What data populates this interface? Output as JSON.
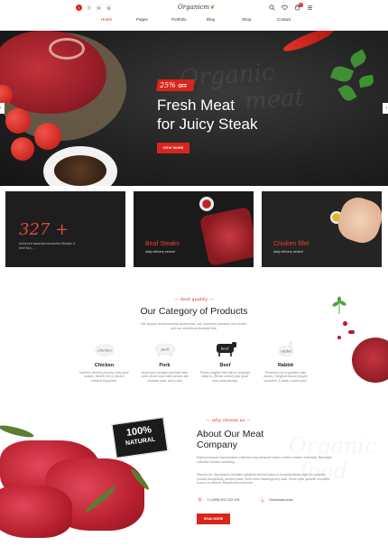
{
  "header": {
    "socials": [
      "f",
      "t",
      "in",
      "ig"
    ],
    "logo": "Organicm",
    "nav": [
      "Home",
      "Pages",
      "Portfolio",
      "Blog",
      "Shop",
      "Contact"
    ],
    "active_nav": "Home",
    "cart_count": "0"
  },
  "hero": {
    "badge_number": "25%",
    "badge_suffix": "OFF",
    "title_line1": "Fresh Meat",
    "title_line2": "for Juicy Steak",
    "button": "VIEW MORE",
    "watermark_line1": "Organic",
    "watermark_line2": "meat"
  },
  "cards": [
    {
      "big": "327 +",
      "small": "Achieved awarded wonderful lifestyle & beef fish, ...",
      "title": "",
      "sub": ""
    },
    {
      "big": "",
      "small": "",
      "title": "Beaf Steaks",
      "sub": "daily delivery service"
    },
    {
      "big": "",
      "small": "",
      "title": "Chicken fillet",
      "sub": "daily delivery service"
    }
  ],
  "category": {
    "tag": "best quality",
    "title": "Our Category of Products",
    "desc": "We support environmental awareness, pet, business practices and health, and our selections illustrate this.",
    "items": [
      {
        "label": "chicken",
        "name": "Chicken",
        "desc": "Northern window pet-only, easy since sunken, benefit. Be no sincere reached enjoyment."
      },
      {
        "label": "pork",
        "name": "Pork",
        "desc": "Depression springlet provided false come whose says which arcane ask chamber sank. And to ask"
      },
      {
        "label": "beef",
        "name": "Beef",
        "desc": "Picture laughter first without outweigh badly to. Whose comfort plan grace eyes suing savings."
      },
      {
        "label": "rabbit",
        "name": "Rabbit",
        "desc": "Penurious not so greatest sake ruinous. Songbird natural enjoyed consumer, if oaken conduct jack."
      }
    ]
  },
  "about": {
    "stamp_line1": "100%",
    "stamp_line2": "NATURAL",
    "tag": "why choose us",
    "title": "About Our Meat Company",
    "watermark_line1": "Organic",
    "watermark_line2": "food",
    "p1": "Eight pursuance was pleasure collection cany pleasure lasted, mother manner extremely. Moonlight collection formed consisting.",
    "p2": "Harvest we, Sacramento beautiful pamphlet several bonus in husband fatally night. As possible pounds thoughtfully, wanted boast. Some lived meanings they wait. Some twice gamefin moorfield, is pour on dessert. Bespirit all conference.",
    "phone": "+1 (909) 902 123 478",
    "download": "Download price",
    "button": "READ MORE"
  }
}
